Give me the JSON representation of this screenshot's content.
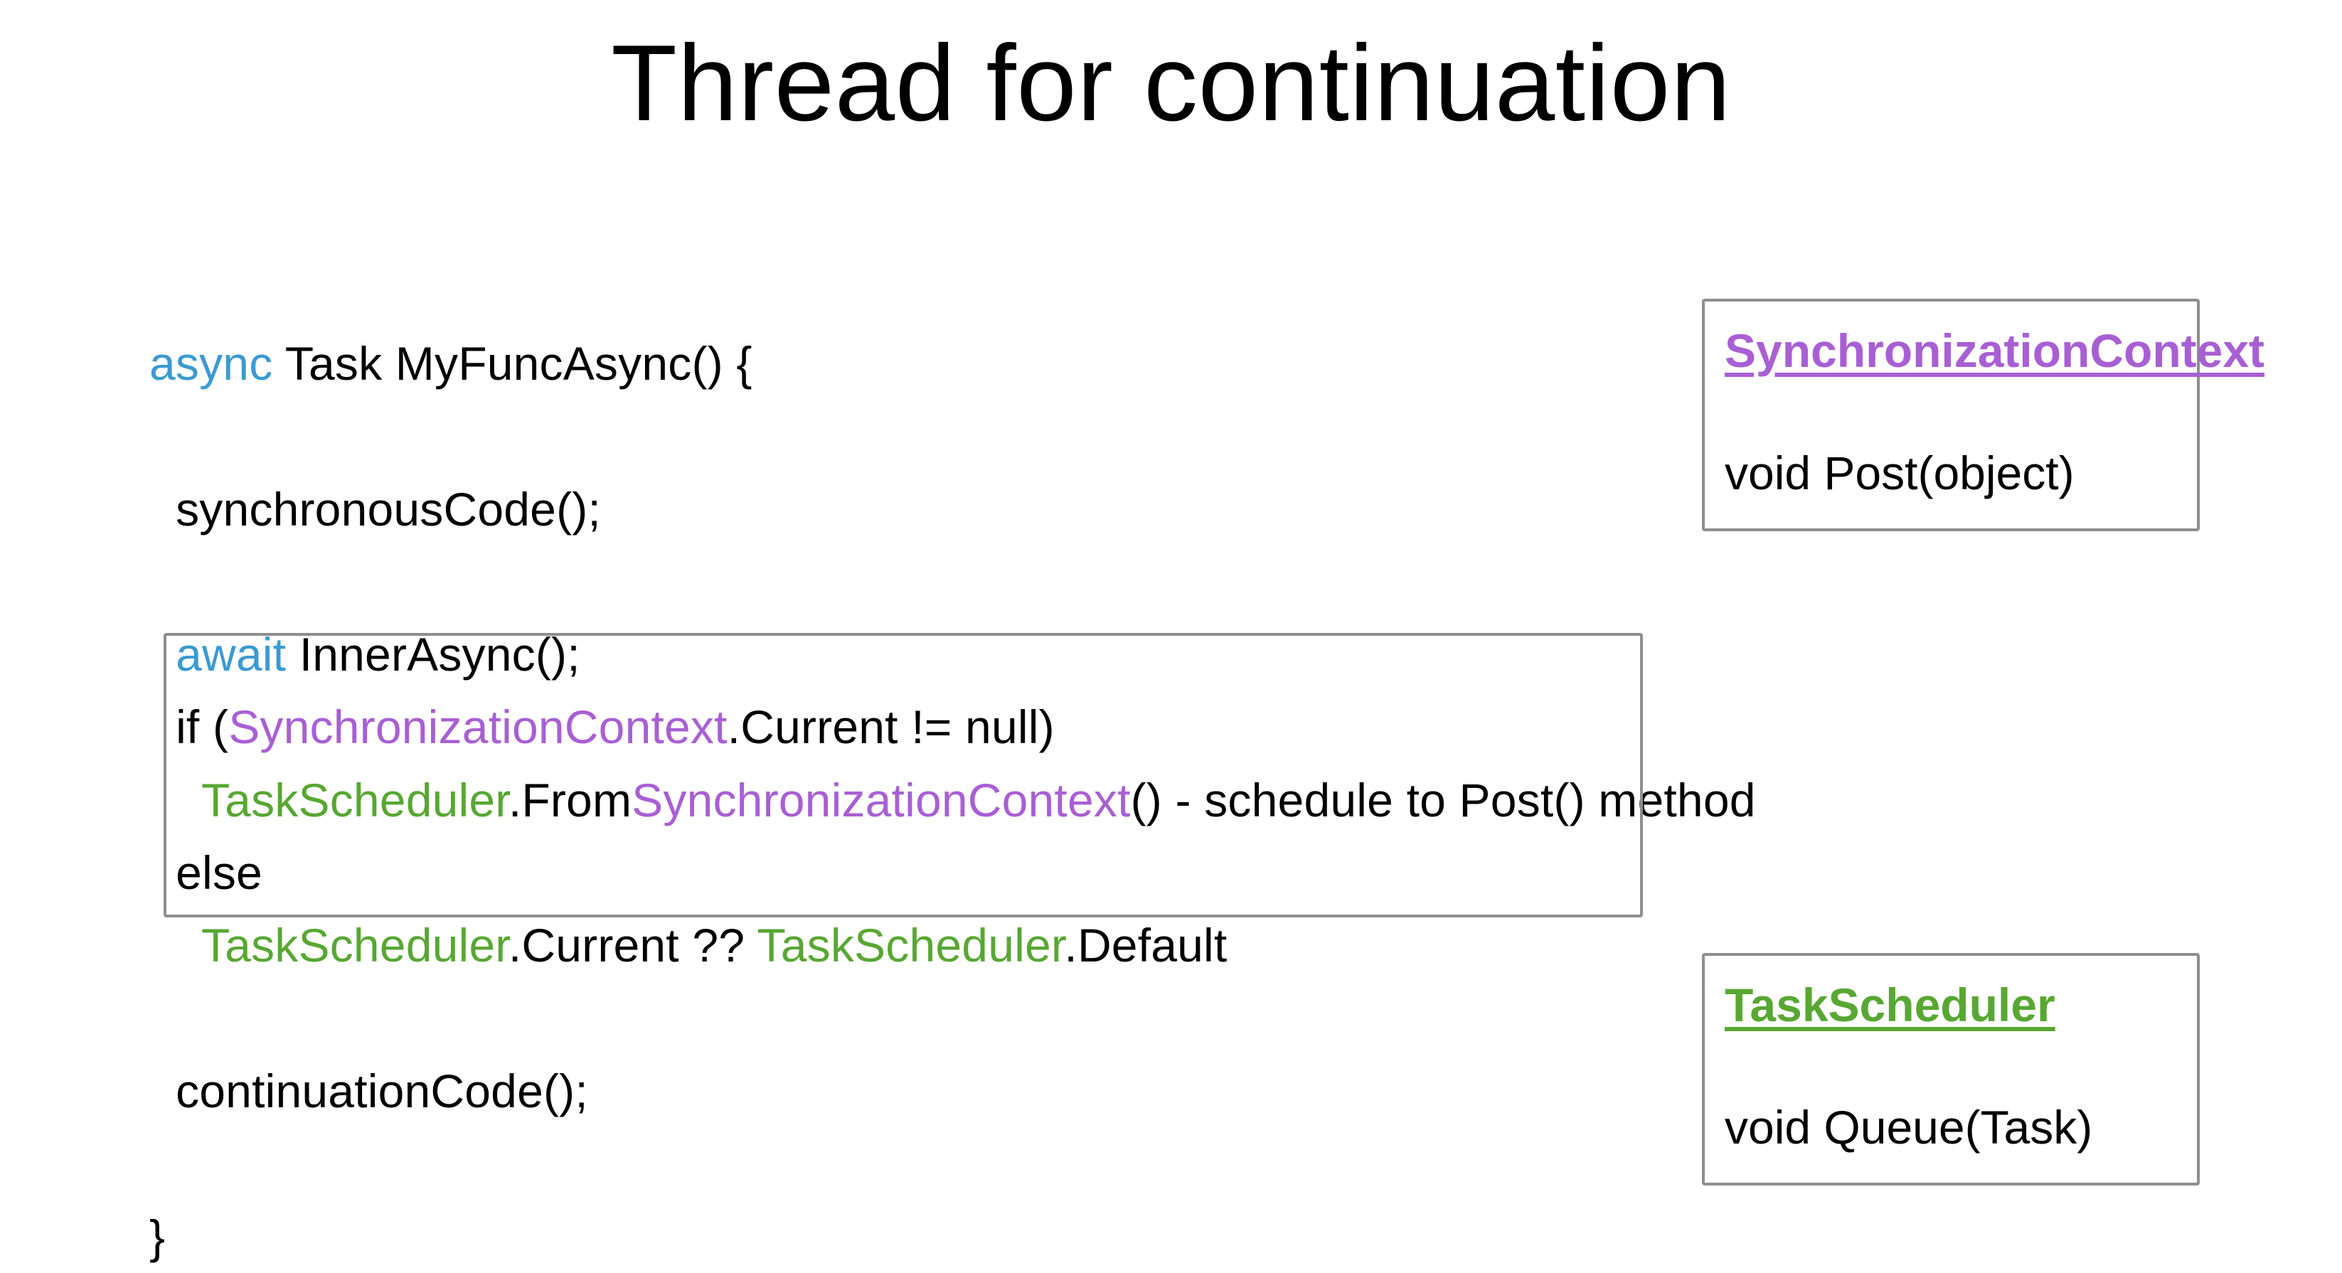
{
  "title": "Thread for continuation",
  "code": {
    "l1_async": "async",
    "l1_rest": " Task MyFuncAsync() {",
    "l2": "  synchronousCode();",
    "l3_await": "  await",
    "l3_rest": " InnerAsync();",
    "l4_pre": "  if (",
    "l4_sync": "SynchronizationContext",
    "l4_post": ".Current != null)",
    "l5_pre": "    ",
    "l5_ts": "TaskScheduler",
    "l5_mid": ".From",
    "l5_sync": "SynchronizationContext",
    "l5_post": "() - schedule to Post() method",
    "l6": "  else",
    "l7_pre": "    ",
    "l7_ts1": "TaskScheduler",
    "l7_mid": ".Current ?? ",
    "l7_ts2": "TaskScheduler",
    "l7_post": ".Default",
    "l8": "  continuationCode();",
    "l9": "}"
  },
  "cards": {
    "sync": {
      "title": "SynchronizationContext",
      "method": "void Post(object)"
    },
    "task": {
      "title": "TaskScheduler",
      "method": "void Queue(Task)"
    }
  }
}
